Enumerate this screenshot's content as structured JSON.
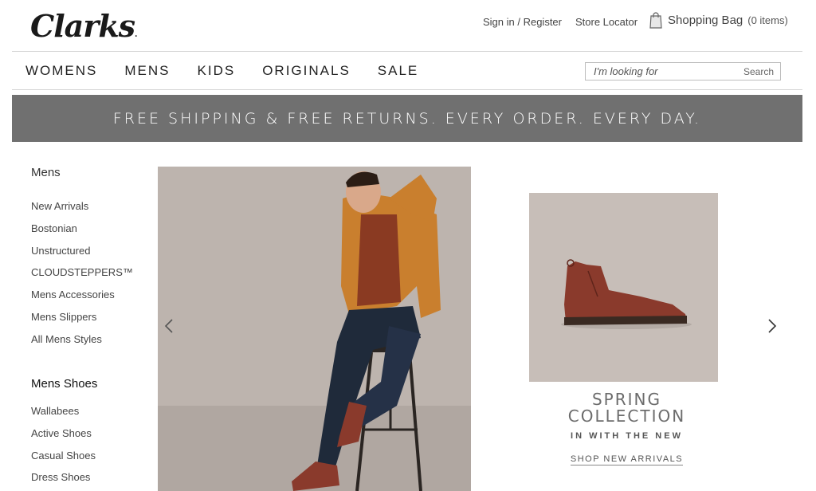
{
  "header": {
    "logo_text": "Clarks",
    "sign_in": "Sign in / Register",
    "store_locator": "Store Locator",
    "bag_label": "Shopping Bag",
    "bag_count": "(0 items)"
  },
  "nav": {
    "items": [
      "WOMENS",
      "MENS",
      "KIDS",
      "ORIGINALS",
      "SALE"
    ]
  },
  "search": {
    "placeholder": "I'm looking for",
    "button": "Search"
  },
  "banner": {
    "text": "FREE SHIPPING & FREE RETURNS. EVERY ORDER. EVERY DAY."
  },
  "sidebar": {
    "heading1": "Mens",
    "links1": [
      "New Arrivals",
      "Bostonian",
      "Unstructured",
      "CLOUDSTEPPERS™",
      "Mens Accessories",
      "Mens Slippers",
      "All Mens Styles"
    ],
    "heading2": "Mens Shoes",
    "links2": [
      "Wallabees",
      "Active Shoes",
      "Casual Shoes",
      "Dress Shoes"
    ]
  },
  "promo": {
    "title_line1": "SPRING",
    "title_line2": "COLLECTION",
    "subtitle": "IN WITH THE NEW",
    "cta": "SHOP NEW ARRIVALS"
  },
  "colors": {
    "banner_bg": "#707070",
    "hero_bg": "#bcb3ad",
    "boot": "#8a3a2c",
    "jacket": "#c97f2e"
  },
  "icons": [
    "shopping-bag-icon",
    "chevron-left-icon",
    "chevron-right-icon"
  ]
}
